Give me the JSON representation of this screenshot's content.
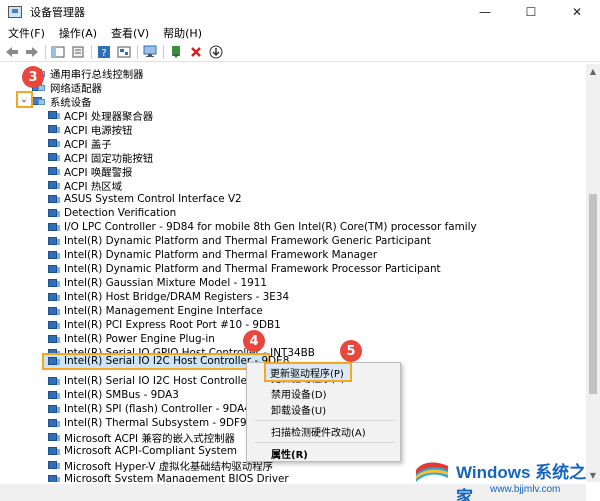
{
  "window": {
    "title": "设备管理器",
    "minimize": "—",
    "maximize": "☐",
    "close": "✕"
  },
  "menu": [
    "文件(F)",
    "操作(A)",
    "查看(V)",
    "帮助(H)"
  ],
  "tree": {
    "partial_top": "通用串行总线控制器",
    "network": "网络适配器",
    "system_devices": "系统设备",
    "expander_glyph": "⌄",
    "children": [
      "ACPI 处理器聚合器",
      "ACPI 电源按钮",
      "ACPI 盖子",
      "ACPI 固定功能按钮",
      "ACPI 唤醒警报",
      "ACPI 热区域",
      "ASUS System Control Interface V2",
      "Detection Verification",
      "I/O LPC Controller - 9D84 for mobile 8th Gen Intel(R) Core(TM) processor family",
      "Intel(R) Dynamic Platform and Thermal Framework Generic Participant",
      "Intel(R) Dynamic Platform and Thermal Framework Manager",
      "Intel(R) Dynamic Platform and Thermal Framework Processor Participant",
      "Intel(R) Gaussian Mixture Model - 1911",
      "Intel(R) Host Bridge/DRAM Registers - 3E34",
      "Intel(R) Management Engine Interface",
      "Intel(R) PCI Express Root Port #10 - 9DB1",
      "Intel(R) Power Engine Plug-in",
      "Intel(R) Serial IO GPIO Host Controller - INT34BB",
      "Intel(R) Serial IO I2C Host Controller - 9DE8",
      "Intel(R) Serial IO I2C Host Controller - 9DE9",
      "Intel(R) SMBus - 9DA3",
      "Intel(R) SPI (flash) Controller - 9DA4",
      "Intel(R) Thermal Subsystem - 9DF9",
      "Microsoft ACPI 兼容的嵌入式控制器",
      "Microsoft ACPI-Compliant System",
      "Microsoft Hyper-V 虚拟化基础结构驱动程序",
      "Microsoft System Management BIOS Driver"
    ]
  },
  "context_menu": {
    "update_driver": "更新驱动程序(P)",
    "disable": "禁用设备(D)",
    "uninstall": "卸载设备(U)",
    "scan": "扫描检测硬件改动(A)",
    "properties": "属性(R)"
  },
  "badges": {
    "step3": "3",
    "step4": "4",
    "step5": "5"
  },
  "watermark": {
    "title": "Windows 系统之家",
    "url": "www.bjjmlv.com"
  },
  "colors": {
    "highlight_border": "#f5a623",
    "badge_red": "#e8473d",
    "selection": "#cce4f7",
    "brand_blue": "#1565c0"
  }
}
